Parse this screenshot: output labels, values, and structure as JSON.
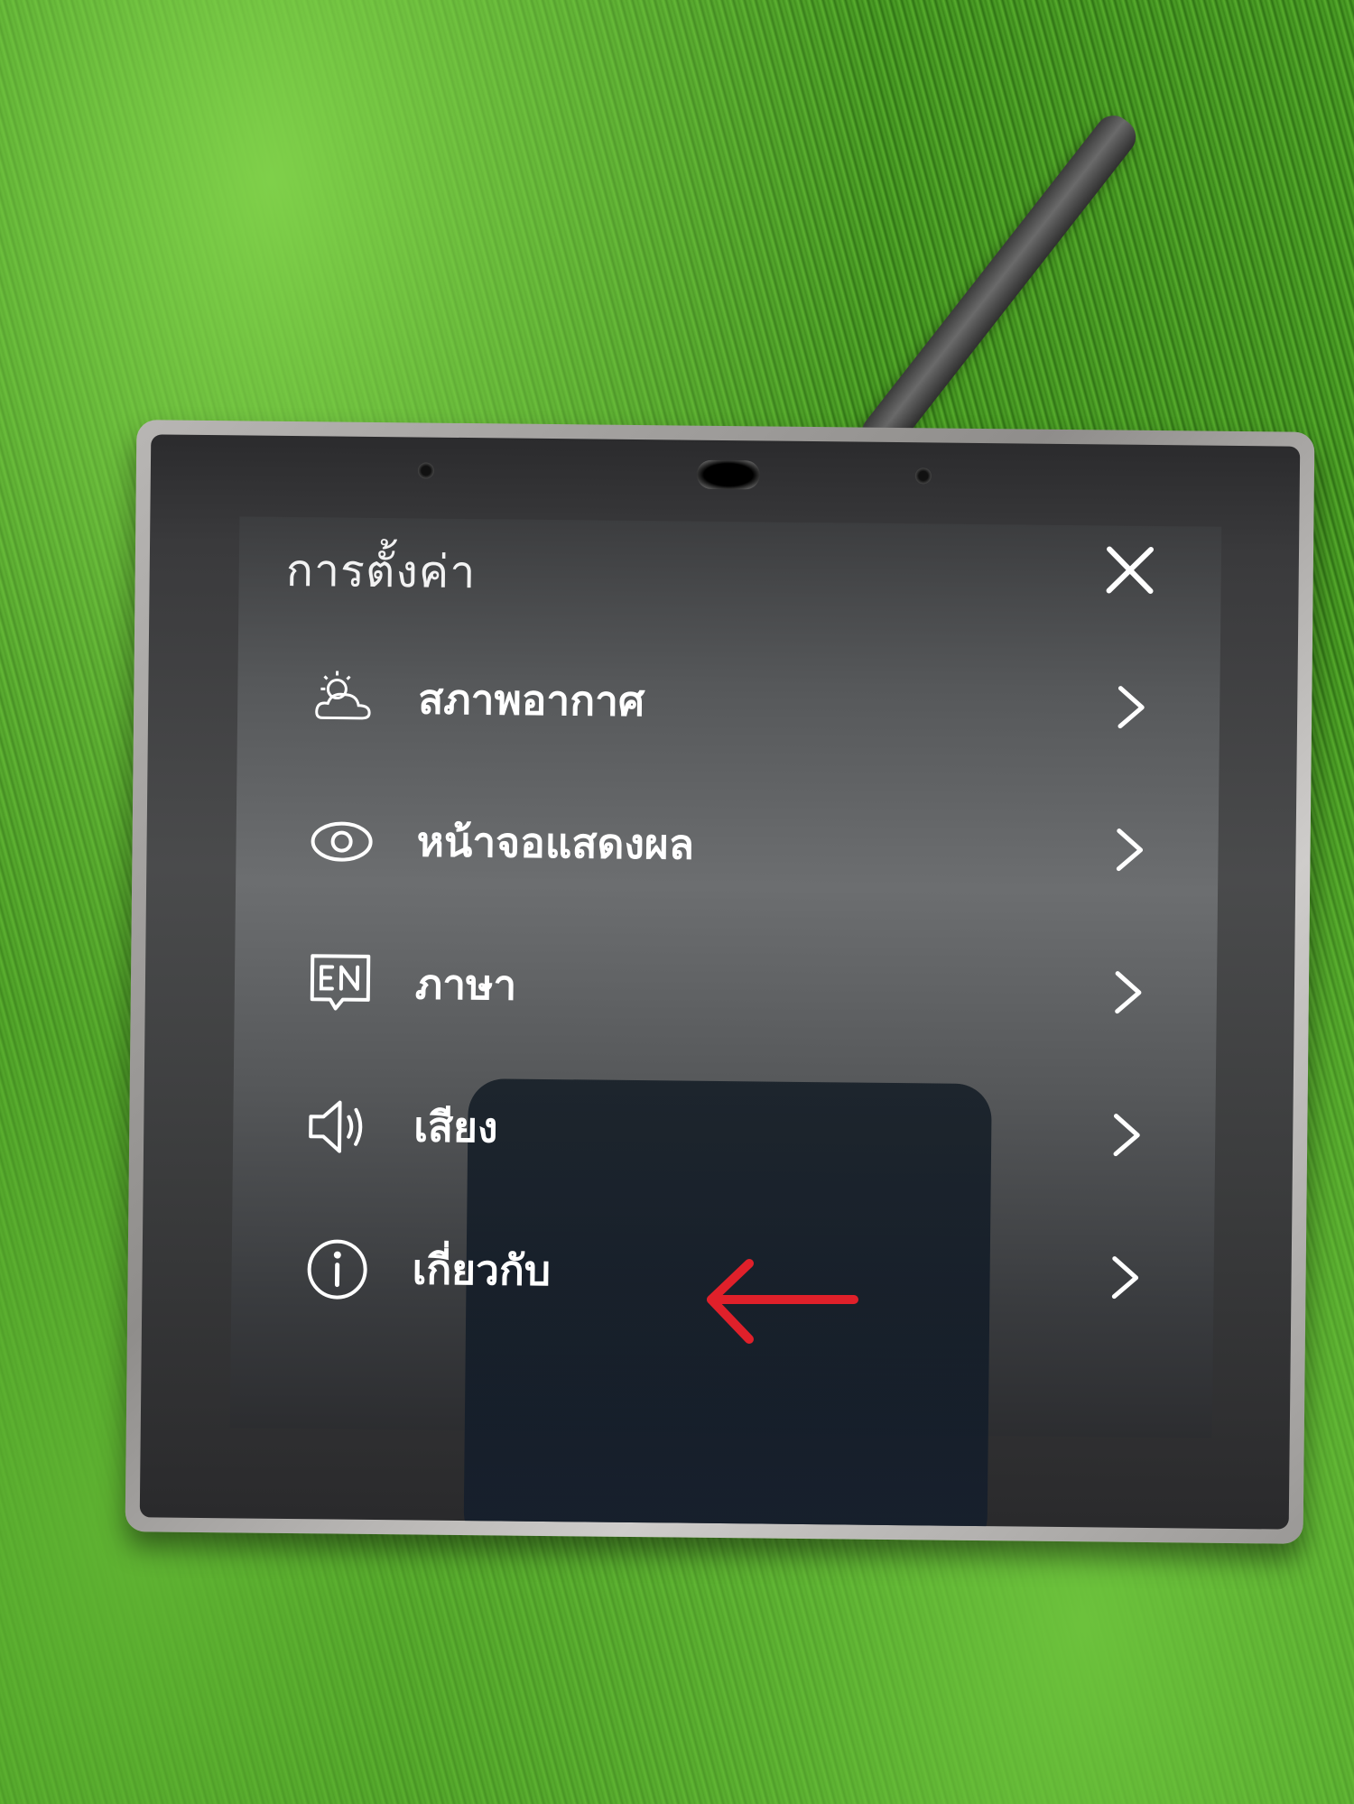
{
  "screen": {
    "title": "การตั้งค่า",
    "close_icon": "close-icon"
  },
  "menu": {
    "items": [
      {
        "label": "สภาพอากาศ",
        "icon": "weather-icon"
      },
      {
        "label": "หน้าจอแสดงผล",
        "icon": "eye-icon"
      },
      {
        "label": "ภาษา",
        "icon": "language-en-icon"
      },
      {
        "label": "เสียง",
        "icon": "speaker-icon"
      },
      {
        "label": "เกี่ยวกับ",
        "icon": "info-icon"
      }
    ]
  },
  "annotation": {
    "arrow_color": "#e0202a",
    "points_to": "เกี่ยวกับ"
  },
  "colors": {
    "text": "#ffffff",
    "background": "#4f5153"
  }
}
